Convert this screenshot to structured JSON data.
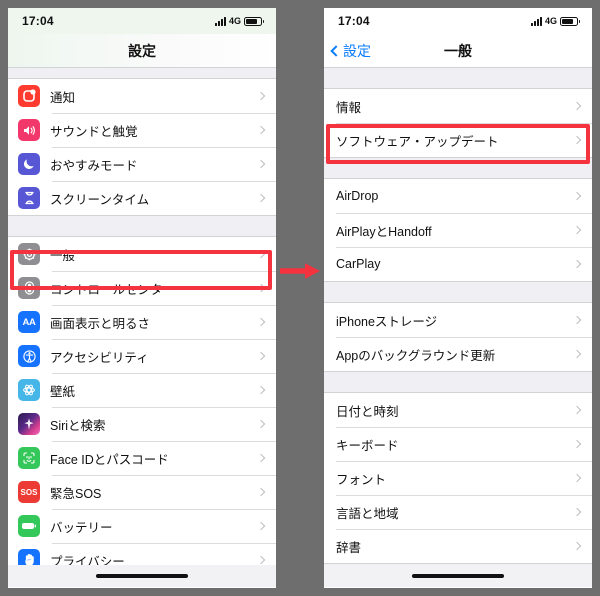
{
  "meta": {
    "accent_red": "#f5333f",
    "ios_blue": "#0a7cff",
    "background_gray": "#6e6e6e"
  },
  "arrow": {
    "name": "right-arrow-annotation"
  },
  "left_phone": {
    "status": {
      "time": "17:04",
      "network": "4G",
      "signal_bars": 4,
      "battery_level": 78
    },
    "nav": {
      "title": "設定"
    },
    "sections": [
      {
        "items": [
          {
            "label": "通知",
            "icon": "notifications-icon",
            "icon_color": "#ff3b30"
          },
          {
            "label": "サウンドと触覚",
            "icon": "sounds-haptics-icon",
            "icon_color": "#f2386a"
          },
          {
            "label": "おやすみモード",
            "icon": "do-not-disturb-icon",
            "icon_color": "#5757d6"
          },
          {
            "label": "スクリーンタイム",
            "icon": "screen-time-icon",
            "icon_color": "#5757d6"
          }
        ]
      },
      {
        "items": [
          {
            "label": "一般",
            "icon": "general-gear-icon",
            "icon_color": "#8e8e93",
            "highlighted": true
          },
          {
            "label": "コントロールセンター",
            "icon": "control-center-icon",
            "icon_color": "#8e8e93"
          },
          {
            "label": "画面表示と明るさ",
            "icon": "display-brightness-icon",
            "icon_color": "#1573ff"
          },
          {
            "label": "アクセシビリティ",
            "icon": "accessibility-icon",
            "icon_color": "#1573ff"
          },
          {
            "label": "壁紙",
            "icon": "wallpaper-icon",
            "icon_color": "#46b6e8"
          },
          {
            "label": "Siriと検索",
            "icon": "siri-search-icon",
            "icon_color": "#2a1b3d"
          },
          {
            "label": "Face IDとパスコード",
            "icon": "face-id-icon",
            "icon_color": "#34c759"
          },
          {
            "label": "緊急SOS",
            "icon": "emergency-sos-icon",
            "icon_color": "#ec3b35"
          },
          {
            "label": "バッテリー",
            "icon": "battery-icon",
            "icon_color": "#34c759"
          },
          {
            "label": "プライバシー",
            "icon": "privacy-hand-icon",
            "icon_color": "#1573ff"
          }
        ]
      }
    ]
  },
  "right_phone": {
    "status": {
      "time": "17:04",
      "network": "4G",
      "signal_bars": 4,
      "battery_level": 78
    },
    "nav": {
      "back_label": "設定",
      "title": "一般"
    },
    "sections": [
      {
        "items": [
          {
            "label": "情報"
          },
          {
            "label": "ソフトウェア・アップデート",
            "highlighted": true
          }
        ]
      },
      {
        "items": [
          {
            "label": "AirDrop"
          },
          {
            "label": "AirPlayとHandoff"
          },
          {
            "label": "CarPlay"
          }
        ]
      },
      {
        "items": [
          {
            "label": "iPhoneストレージ"
          },
          {
            "label": "Appのバックグラウンド更新"
          }
        ]
      },
      {
        "items": [
          {
            "label": "日付と時刻"
          },
          {
            "label": "キーボード"
          },
          {
            "label": "フォント"
          },
          {
            "label": "言語と地域"
          },
          {
            "label": "辞書"
          }
        ]
      }
    ]
  }
}
